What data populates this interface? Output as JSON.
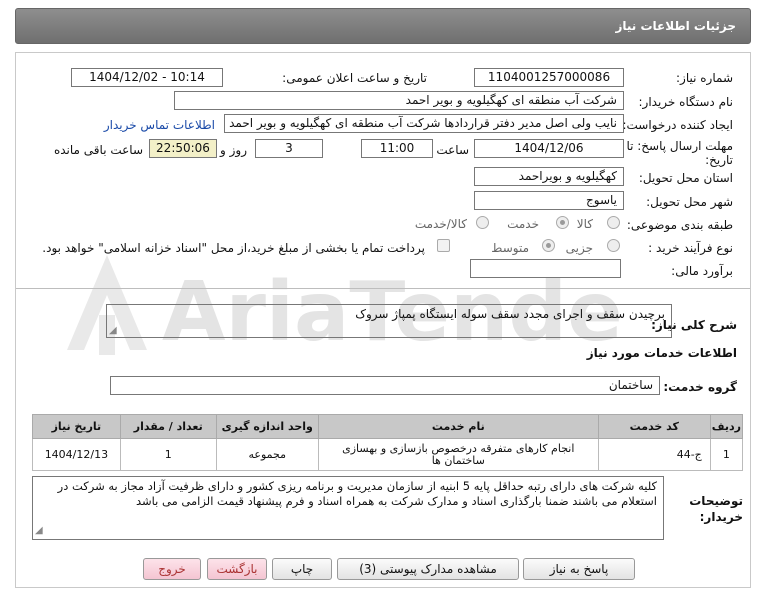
{
  "header": {
    "title": "جزئیات اطلاعات نیاز"
  },
  "need_number": {
    "label": "شماره نیاز:",
    "value": "1104001257000086"
  },
  "announce": {
    "label": "تاریخ و ساعت اعلان عمومی:",
    "value": "1404/12/02 - 10:14"
  },
  "buyer_org": {
    "label": "نام دستگاه خریدار:",
    "value": "شرکت آب منطقه ای کهگیلویه و بویر احمد"
  },
  "requester": {
    "label": "ایجاد کننده درخواست:",
    "value": "نایب ولی اصل مدیر دفتر قراردادها شرکت آب منطقه ای کهگیلویه و بویر احمد",
    "contact_link": "اطلاعات تماس خریدار"
  },
  "deadline": {
    "label_line1": "مهلت ارسال پاسخ: تا",
    "label_line2": "تاریخ:",
    "date": "1404/12/06",
    "time_label": "ساعت",
    "time": "11:00",
    "days": "3",
    "days_label": "روز و",
    "remaining": "22:50:06",
    "remaining_label": "ساعت باقی مانده"
  },
  "province": {
    "label": "استان محل تحویل:",
    "value": "کهگیلویه و بویراحمد"
  },
  "city": {
    "label": "شهر محل تحویل:",
    "value": "یاسوج"
  },
  "category": {
    "label": "طبقه بندی موضوعی:",
    "options": [
      "کالا",
      "خدمت",
      "کالا/خدمت"
    ],
    "selected": "خدمت"
  },
  "purchase_type": {
    "label": "نوع فرآیند خرید :",
    "options": [
      "جزیی",
      "متوسط"
    ],
    "selected": "متوسط",
    "note": "پرداخت تمام یا بخشی از مبلغ خرید،از محل \"اسناد خزانه اسلامی\" خواهد بود."
  },
  "estimate": {
    "label": "برآورد مالی:",
    "value": ""
  },
  "summary": {
    "label": "شرح کلی نیاز:",
    "value": "برچیدن سقف و اجرای مجدد سقف سوله ایستگاه پمپاژ سروک"
  },
  "services_title": "اطلاعات خدمات مورد نیاز",
  "service_group": {
    "label": "گروه خدمت:",
    "value": "ساختمان"
  },
  "table": {
    "headers": [
      "ردیف",
      "کد خدمت",
      "نام خدمت",
      "واحد اندازه گیری",
      "تعداد / مقدار",
      "تاریخ نیاز"
    ],
    "rows": [
      [
        "1",
        "ج-44",
        "انجام کارهای متفرقه درخصوص بازسازی و بهسازی ساختمان ها",
        "مجموعه",
        "1",
        "1404/12/13"
      ]
    ]
  },
  "buyer_notes": {
    "label_line1": "توضیحات",
    "label_line2": "خریدار:",
    "value": "کلیه شرکت های دارای  رتبه حداقل پایه 5 ابنیه از سازمان مدیریت و برنامه ریزی کشور و دارای ظرفیت آزاد مجاز به شرکت در استعلام می باشند ضمنا بارگذاری اسناد و مدارک شرکت به همراه اسناد و فرم پیشنهاد قیمت الزامی می باشد"
  },
  "buttons": {
    "reply": "پاسخ به نیاز",
    "attachments": "مشاهده مدارک پیوستی (3)",
    "print": "چاپ",
    "back": "بازگشت",
    "exit": "خروج"
  },
  "colors": {
    "header": "#7d7d7d",
    "link": "#1a4aa8",
    "remaining_bg": "#f3f0c8",
    "pink_button": "#f4c5d2"
  }
}
